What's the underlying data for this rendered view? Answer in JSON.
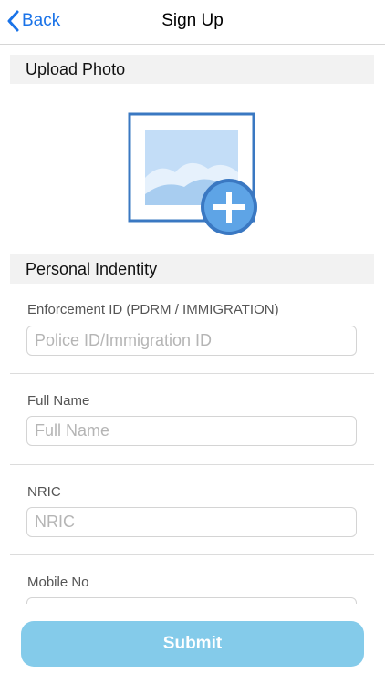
{
  "header": {
    "back_label": "Back",
    "title": "Sign Up"
  },
  "sections": {
    "upload_photo": "Upload Photo",
    "personal_identity": "Personal Indentity"
  },
  "icons": {
    "back": "chevron-left-icon",
    "photo": "image-placeholder-icon",
    "add": "plus-circle-icon"
  },
  "fields": {
    "enforcement_id": {
      "label": "Enforcement ID (PDRM / IMMIGRATION)",
      "placeholder": "Police ID/Immigration ID",
      "value": ""
    },
    "full_name": {
      "label": "Full Name",
      "placeholder": "Full Name",
      "value": ""
    },
    "nric": {
      "label": "NRIC",
      "placeholder": "NRIC",
      "value": ""
    },
    "mobile_no": {
      "label": "Mobile No",
      "placeholder": "",
      "value": ""
    }
  },
  "submit_label": "Submit",
  "colors": {
    "accent": "#1a73e8",
    "submit_bg": "#84cbea",
    "photo_frame": "#3a78c2",
    "section_bg": "#f2f2f2"
  }
}
